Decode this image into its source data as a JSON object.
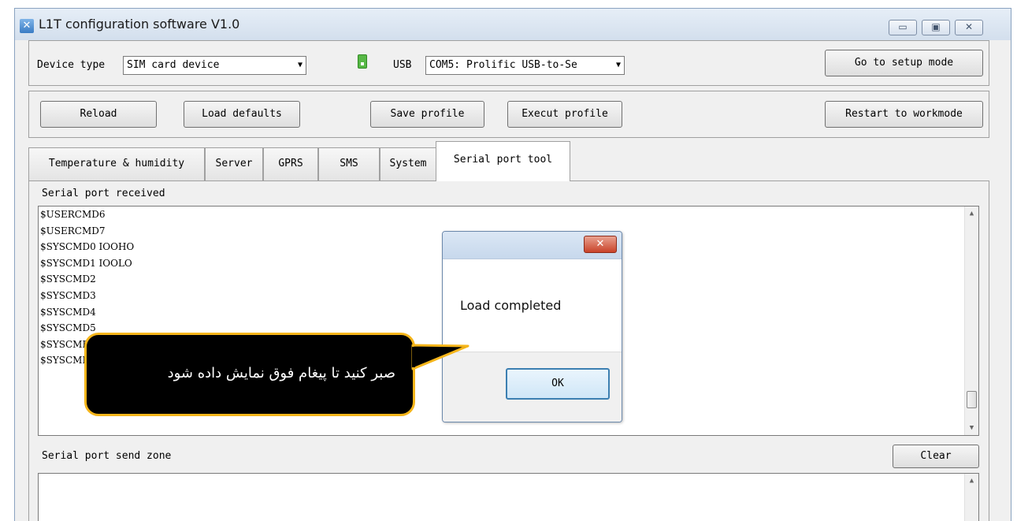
{
  "window": {
    "title": "L1T configuration software V1.0",
    "controls": [
      "▭",
      "▣",
      "✕"
    ]
  },
  "toolbar": {
    "device_type_label": "Device type",
    "device_type_value": "SIM card device",
    "usb_label": "USB",
    "port_value": "COM5: Prolific USB-to-Se",
    "setup_button": "Go to setup mode",
    "reload_button": "Reload",
    "load_defaults_button": "Load defaults",
    "save_profile_button": "Save profile",
    "execut_profile_button": "Execut profile",
    "restart_button": "Restart to workmode"
  },
  "tabs": [
    {
      "label": "Temperature & humidity"
    },
    {
      "label": "Server"
    },
    {
      "label": "GPRS"
    },
    {
      "label": "SMS"
    },
    {
      "label": "System"
    },
    {
      "label": "Serial port tool"
    }
  ],
  "serial_tool": {
    "received_label": "Serial port received",
    "received_lines": [
      "$USERCMD6",
      "$USERCMD7",
      "$SYSCMD0 IOOHO",
      "$SYSCMD1 IOOLO",
      "$SYSCMD2",
      "$SYSCMD3",
      "$SYSCMD4",
      "$SYSCMD5",
      "$SYSCMD6",
      "$SYSCMD7"
    ],
    "send_label": "Serial port send zone",
    "clear_button": "Clear"
  },
  "dialog": {
    "close": "✕",
    "message": "Load completed",
    "ok_button": "OK"
  },
  "callout": {
    "text": "صبر کنید تا پیغام فوق نمایش داده شود",
    "border_color": "#f5b51a"
  },
  "icons": {
    "app": "app-icon",
    "usb": "usb-icon",
    "dropdown": "▼",
    "scroll_up": "▲",
    "scroll_down": "▼"
  }
}
